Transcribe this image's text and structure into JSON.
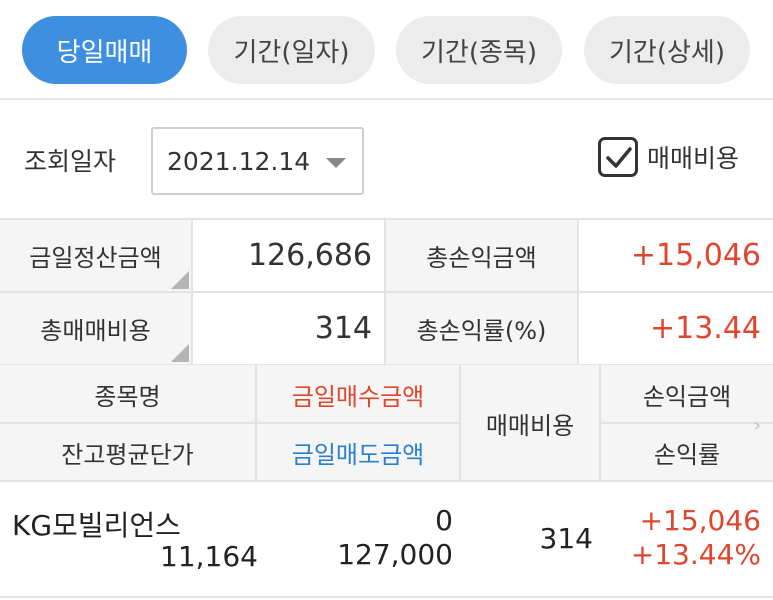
{
  "tabs": [
    {
      "label": "당일매매",
      "active": true
    },
    {
      "label": "기간(일자)",
      "active": false
    },
    {
      "label": "기간(종목)",
      "active": false
    },
    {
      "label": "기간(상세)",
      "active": false
    }
  ],
  "query": {
    "date_label": "조회일자",
    "date_value": "2021.12.14",
    "fee_checkbox_label": "매매비용",
    "fee_checked": true
  },
  "summary": {
    "settlement_label": "금일정산금액",
    "settlement_value": "126,686",
    "total_pnl_label": "총손익금액",
    "total_pnl_value": "+15,046",
    "total_fee_label": "총매매비용",
    "total_fee_value": "314",
    "total_pnl_rate_label": "총손익률(%)",
    "total_pnl_rate_value": "+13.44"
  },
  "table": {
    "headers": {
      "name": "종목명",
      "avg_price": "잔고평균단가",
      "buy_amount": "금일매수금액",
      "sell_amount": "금일매도금액",
      "fee": "매매비용",
      "pnl": "손익금액",
      "pnl_rate": "손익률"
    },
    "rows": [
      {
        "name": "KG모빌리언스",
        "avg_price": "11,164",
        "buy_amount": "0",
        "sell_amount": "127,000",
        "fee": "314",
        "pnl": "+15,046",
        "pnl_rate": "+13.44%"
      }
    ]
  },
  "colors": {
    "accent": "#3e8fe0",
    "profit": "#e0462e",
    "sell": "#2a7fd0"
  }
}
